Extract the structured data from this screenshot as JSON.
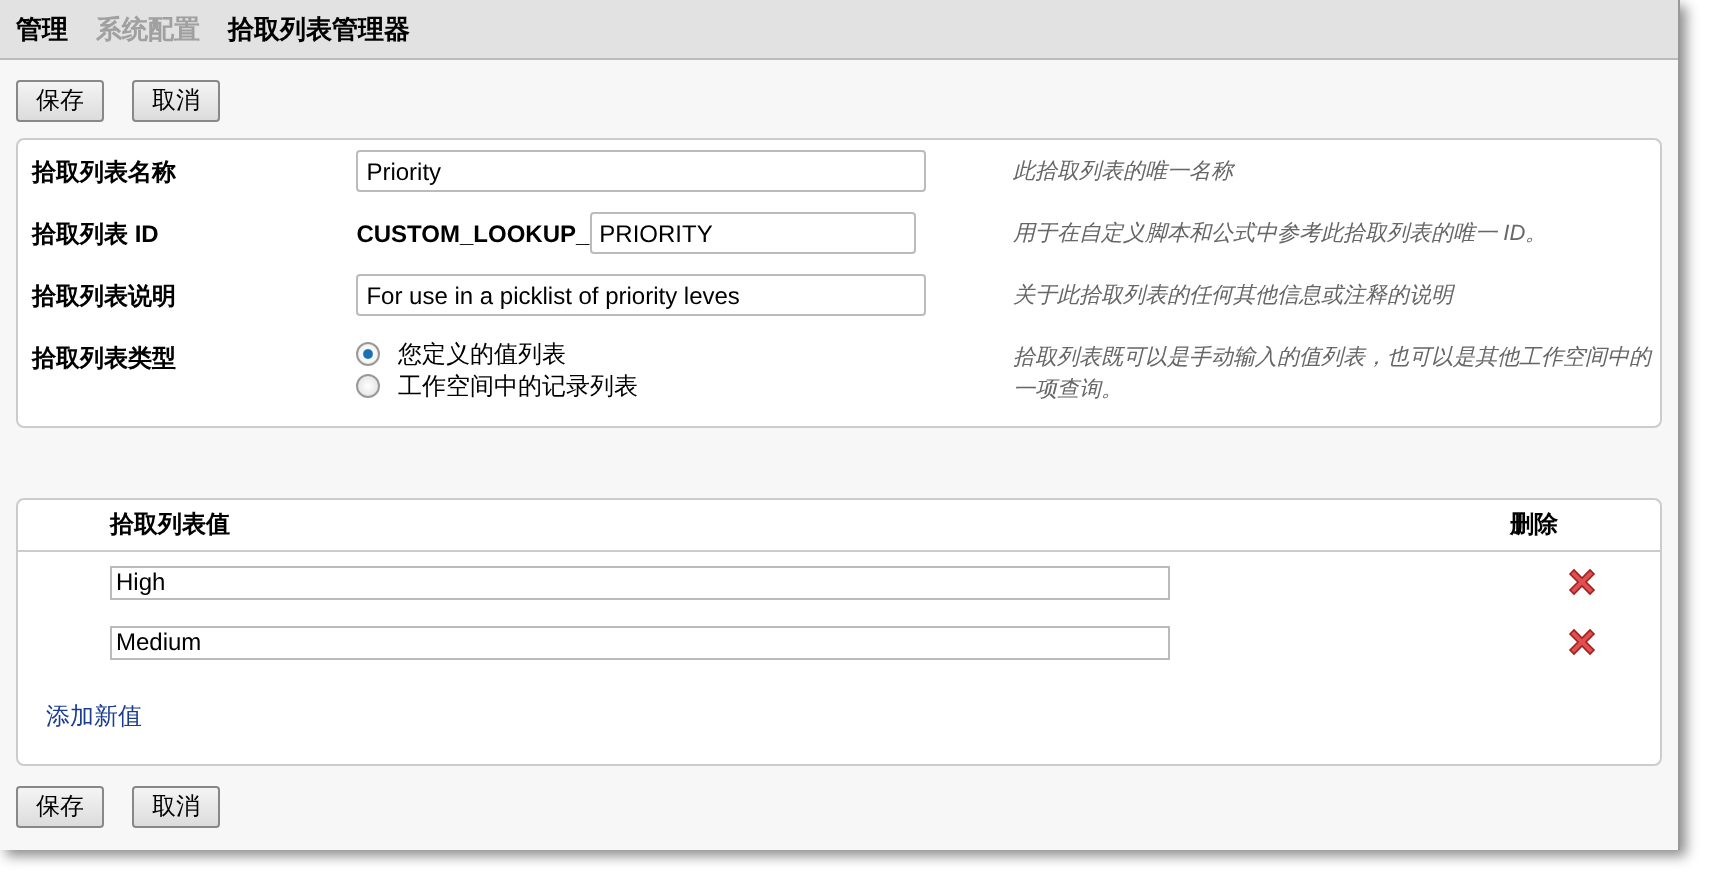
{
  "breadcrumb": [
    {
      "label": "管理",
      "muted": false
    },
    {
      "label": "系统配置",
      "muted": true
    },
    {
      "label": "拾取列表管理器",
      "muted": false
    }
  ],
  "top_buttons": [
    "保存",
    "取消"
  ],
  "form": [
    {
      "kind": "text",
      "label": "拾取列表名称",
      "value": "Priority",
      "hint": "此拾取列表的唯一名称"
    },
    {
      "kind": "prefixed",
      "label": "拾取列表 ID",
      "prefix": "CUSTOM_LOOKUP_",
      "value": "PRIORITY",
      "hint": "用于在自定义脚本和公式中参考此拾取列表的唯一 ID。"
    },
    {
      "kind": "text",
      "label": "拾取列表说明",
      "value": "For use in a picklist of priority leves",
      "hint": "关于此拾取列表的任何其他信息或注释的说明"
    },
    {
      "kind": "radio",
      "label": "拾取列表类型",
      "options": [
        {
          "label": "您定义的值列表",
          "selected": true
        },
        {
          "label": "工作空间中的记录列表",
          "selected": false
        }
      ],
      "hint": "拾取列表既可以是手动输入的值列表，也可以是其他工作空间中的一项查询。"
    }
  ],
  "values_table": {
    "columns": [
      "拾取列表值",
      "删除"
    ],
    "rows": [
      {
        "value": "High"
      },
      {
        "value": "Medium"
      }
    ],
    "add_link": "添加新值"
  },
  "bottom_buttons": [
    "保存",
    "取消"
  ]
}
